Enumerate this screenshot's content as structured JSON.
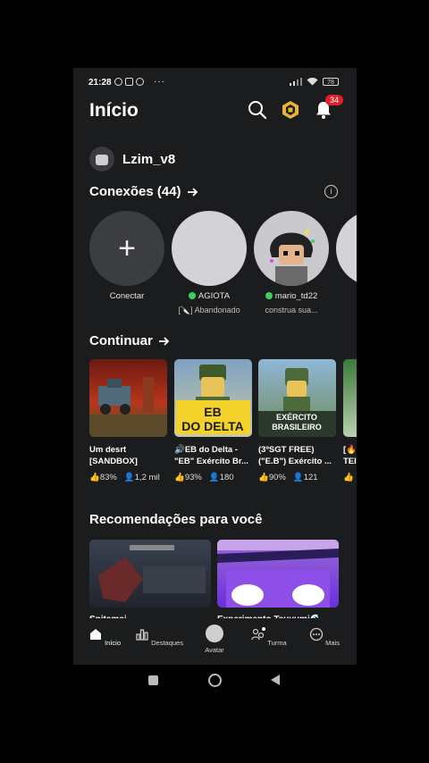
{
  "status_bar": {
    "time": "21:28",
    "dots": "···",
    "battery": "78"
  },
  "header": {
    "title": "Início",
    "notification_count": "34"
  },
  "user": {
    "username": "Lzim_v8"
  },
  "connections": {
    "title": "Conexões (44)",
    "items": [
      {
        "name": "Conectar",
        "status": ""
      },
      {
        "name": "AGIOTA",
        "status": "[🔪] Abandonado"
      },
      {
        "name": "mario_td22",
        "status": "construa sua..."
      }
    ]
  },
  "continue_section": {
    "title": "Continuar",
    "games": [
      {
        "name": "Um desrt [SANDBOX]",
        "rating": "83%",
        "players": "1,2 mil"
      },
      {
        "name": "🔊EB do Delta - \"EB\" Exército Br...",
        "rating": "93%",
        "players": "180"
      },
      {
        "name": "(3ºSGT FREE) (\"E.B\") Exército ...",
        "rating": "90%",
        "players": "121"
      },
      {
        "name": "[🔥 TEI",
        "rating": "",
        "players": ""
      }
    ]
  },
  "recommendations": {
    "title": "Recomendações para você",
    "items": [
      {
        "label": "Snitamai"
      },
      {
        "label": "Experimento Tsuyumi🌊"
      }
    ]
  },
  "bottom_nav": {
    "items": [
      {
        "label": "Início",
        "icon": "home-icon"
      },
      {
        "label": "Destaques",
        "icon": "charts-icon"
      },
      {
        "label": "Avatar",
        "icon": "avatar-icon"
      },
      {
        "label": "Turma",
        "icon": "people-icon"
      },
      {
        "label": "Mais",
        "icon": "more-icon"
      }
    ]
  },
  "colors": {
    "background": "#1b1c1e",
    "badge": "#e0202b",
    "online": "#3ecf62"
  }
}
